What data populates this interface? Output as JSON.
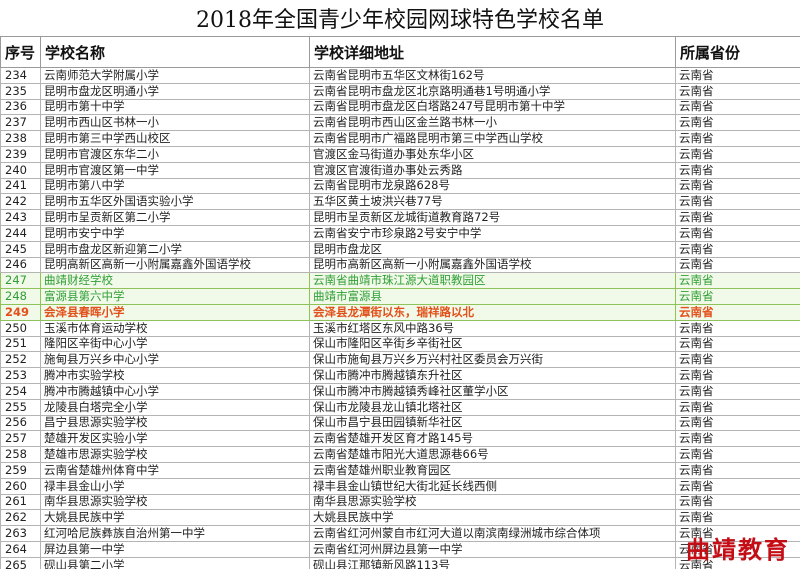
{
  "title": "2018年全国青少年校园网球特色学校名单",
  "headers": [
    "序号",
    "学校名称",
    "学校详细地址",
    "所属省份"
  ],
  "rows": [
    {
      "seq": "234",
      "name": "云南师范大学附属小学",
      "addr": "云南省昆明市五华区文林街162号",
      "prov": "云南省"
    },
    {
      "seq": "235",
      "name": "昆明市盘龙区明通小学",
      "addr": "云南省昆明市盘龙区北京路明通巷1号明通小学",
      "prov": "云南省"
    },
    {
      "seq": "236",
      "name": "昆明市第十中学",
      "addr": "云南省昆明市盘龙区白塔路247号昆明市第十中学",
      "prov": "云南省"
    },
    {
      "seq": "237",
      "name": "昆明市西山区书林一小",
      "addr": "云南省昆明市西山区金兰路书林一小",
      "prov": "云南省"
    },
    {
      "seq": "238",
      "name": "昆明市第三中学西山校区",
      "addr": "云南省昆明市广福路昆明市第三中学西山学校",
      "prov": "云南省"
    },
    {
      "seq": "239",
      "name": "昆明市官渡区东华二小",
      "addr": "官渡区金马街道办事处东华小区",
      "prov": "云南省"
    },
    {
      "seq": "240",
      "name": "昆明市官渡区第一中学",
      "addr": "官渡区官渡街道办事处云秀路",
      "prov": "云南省"
    },
    {
      "seq": "241",
      "name": "昆明市第八中学",
      "addr": "云南省昆明市龙泉路628号",
      "prov": "云南省"
    },
    {
      "seq": "242",
      "name": "昆明市五华区外国语实验小学",
      "addr": "五华区黄土坡洪兴巷77号",
      "prov": "云南省"
    },
    {
      "seq": "243",
      "name": "昆明市呈贡新区第二小学",
      "addr": "昆明市呈贡新区龙城街道教育路72号",
      "prov": "云南省"
    },
    {
      "seq": "244",
      "name": "昆明市安宁中学",
      "addr": "云南省安宁市珍泉路2号安宁中学",
      "prov": "云南省"
    },
    {
      "seq": "245",
      "name": "昆明市盘龙区新迎第二小学",
      "addr": "昆明市盘龙区",
      "prov": "云南省"
    },
    {
      "seq": "246",
      "name": "昆明高新区高新一小附属嘉鑫外国语学校",
      "addr": "昆明市高新区高新一小附属嘉鑫外国语学校",
      "prov": "云南省"
    },
    {
      "seq": "247",
      "name": "曲靖财经学校",
      "addr": "云南省曲靖市珠江源大道职教园区",
      "prov": "云南省",
      "hl": "hl"
    },
    {
      "seq": "248",
      "name": "富源县第六中学",
      "addr": "曲靖市富源县",
      "prov": "云南省",
      "hl": "hl"
    },
    {
      "seq": "249",
      "name": "会泽县春晖小学",
      "addr": "会泽县龙潭街以东，瑞祥路以北",
      "prov": "云南省",
      "hl": "hl-strong"
    },
    {
      "seq": "250",
      "name": "玉溪市体育运动学校",
      "addr": "玉溪市红塔区东风中路36号",
      "prov": "云南省"
    },
    {
      "seq": "251",
      "name": "隆阳区辛街中心小学",
      "addr": "保山市隆阳区辛街乡辛街社区",
      "prov": "云南省"
    },
    {
      "seq": "252",
      "name": "施甸县万兴乡中心小学",
      "addr": "保山市施甸县万兴乡万兴村社区委员会万兴街",
      "prov": "云南省"
    },
    {
      "seq": "253",
      "name": "腾冲市实验学校",
      "addr": "保山市腾冲市腾越镇东升社区",
      "prov": "云南省"
    },
    {
      "seq": "254",
      "name": "腾冲市腾越镇中心小学",
      "addr": "保山市腾冲市腾越镇秀峰社区董学小区",
      "prov": "云南省"
    },
    {
      "seq": "255",
      "name": "龙陵县白塔完全小学",
      "addr": "保山市龙陵县龙山镇北塔社区",
      "prov": "云南省"
    },
    {
      "seq": "256",
      "name": "昌宁县思源实验学校",
      "addr": "保山市昌宁县田园镇新华社区",
      "prov": "云南省"
    },
    {
      "seq": "257",
      "name": "楚雄开发区实验小学",
      "addr": "云南省楚雄开发区育才路145号",
      "prov": "云南省"
    },
    {
      "seq": "258",
      "name": "楚雄市思源实验学校",
      "addr": "云南省楚雄市阳光大道思源巷66号",
      "prov": "云南省"
    },
    {
      "seq": "259",
      "name": "云南省楚雄州体育中学",
      "addr": "云南省楚雄州职业教育园区",
      "prov": "云南省"
    },
    {
      "seq": "260",
      "name": "禄丰县金山小学",
      "addr": "禄丰县金山镇世纪大街北延长线西侧",
      "prov": "云南省"
    },
    {
      "seq": "261",
      "name": "南华县思源实验学校",
      "addr": "南华县思源实验学校",
      "prov": "云南省"
    },
    {
      "seq": "262",
      "name": "大姚县民族中学",
      "addr": "大姚县民族中学",
      "prov": "云南省"
    },
    {
      "seq": "263",
      "name": "红河哈尼族彝族自治州第一中学",
      "addr": "云南省红河州蒙自市红河大道以南滨南绿洲城市综合体项",
      "prov": "云南省"
    },
    {
      "seq": "264",
      "name": "屏边县第一中学",
      "addr": "云南省红河州屏边县第一中学",
      "prov": "云南省"
    },
    {
      "seq": "265",
      "name": "砚山县第二小学",
      "addr": "砚山县江那镇新风路113号",
      "prov": "云南省"
    }
  ],
  "watermark": "曲靖教育"
}
